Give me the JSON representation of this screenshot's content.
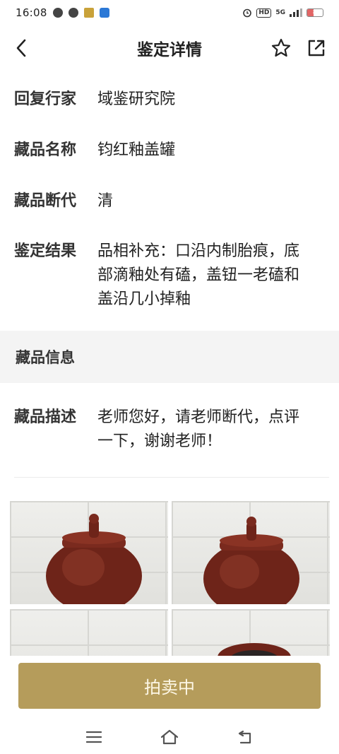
{
  "status_bar": {
    "time": "16:08",
    "network": "5G",
    "battery": "8",
    "hd_label": "HD"
  },
  "header": {
    "title": "鉴定详情"
  },
  "details": [
    {
      "label": "回复行家",
      "value": "域鉴研究院"
    },
    {
      "label": "藏品名称",
      "value": "钧红釉盖罐"
    },
    {
      "label": "藏品断代",
      "value": "清"
    },
    {
      "label": "鉴定结果",
      "value": "品相补充：口沿内制胎痕，底部滴釉处有磕，盖钮一老磕和盖沿几小掉釉"
    }
  ],
  "collection_info": {
    "section_title": "藏品信息",
    "description_label": "藏品描述",
    "description_value": "老师您好，请老师断代，点评一下，谢谢老师！"
  },
  "photos_count": 4,
  "action_button": {
    "label": "拍卖中"
  },
  "colors": {
    "accent": "#b59c5b",
    "section_bg": "#f4f4f4",
    "jar_glaze": "#7a2a1e"
  },
  "icons": {
    "back": "chevron-left-icon",
    "favorite": "star-icon",
    "share": "share-icon",
    "menu": "menu-icon",
    "home": "home-icon",
    "return": "return-icon"
  }
}
